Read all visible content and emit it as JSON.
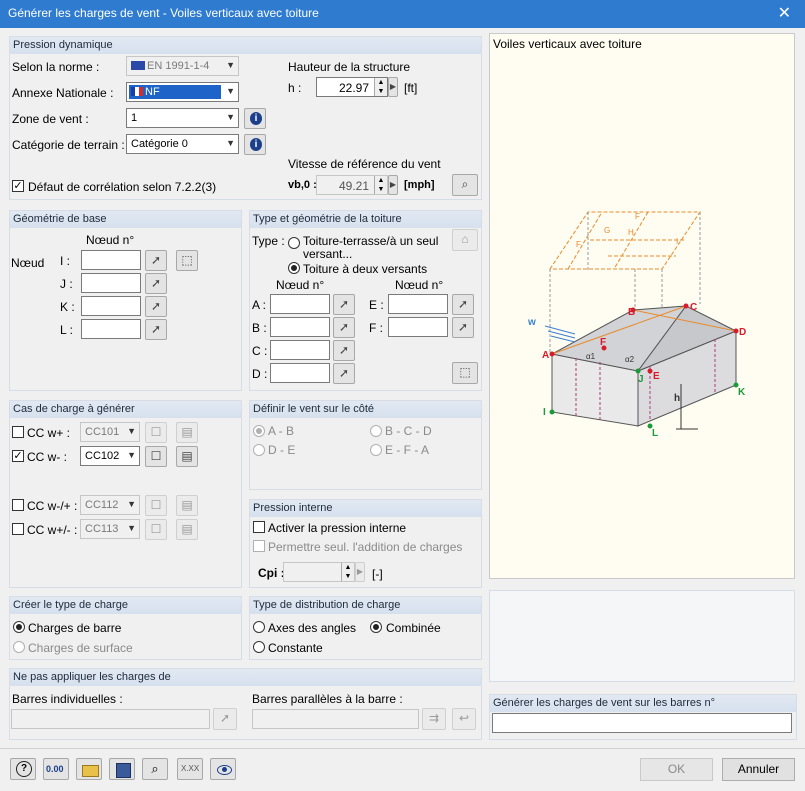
{
  "window": {
    "title": "Générer les charges de vent - Voiles verticaux avec toiture",
    "close": "✕"
  },
  "dyn": {
    "header": "Pression dynamique",
    "norme_label": "Selon la norme :",
    "norme_value": "EN 1991-1-4",
    "annexe_label": "Annexe Nationale :",
    "annexe_value": "NF",
    "zone_label": "Zone de vent :",
    "zone_value": "1",
    "terrain_label": "Catégorie de terrain :",
    "terrain_value": "Catégorie 0",
    "hauteur_label": "Hauteur de la structure",
    "h_label": "h :",
    "h_value": "22.97",
    "h_unit": "[ft]",
    "vitesse_label": "Vitesse de référence du vent",
    "vb_label": "vb,0 :",
    "vb_value": "49.21",
    "vb_unit": "[mph]",
    "correlation_label": "Défaut de corrélation selon 7.2.2(3)"
  },
  "geom": {
    "header": "Géométrie de base",
    "noeud_head": "Nœud n°",
    "noeud": "Nœud",
    "rows": [
      "I :",
      "J :",
      "K :",
      "L :"
    ]
  },
  "roof": {
    "header": "Type et géométrie de la toiture",
    "type_label": "Type :",
    "opt1": "Toiture-terrasse/à un seul",
    "opt1b": "versant...",
    "opt2": "Toiture à deux versants",
    "noeud_head1": "Nœud n°",
    "noeud_head2": "Nœud n°",
    "left": [
      "A :",
      "B :",
      "C :",
      "D :"
    ],
    "right": [
      "E :",
      "F :"
    ]
  },
  "cases": {
    "header": "Cas de charge à générer",
    "rows": [
      {
        "label": "CC w+ :",
        "value": "CC101",
        "checked": false
      },
      {
        "label": "CC w- :",
        "value": "CC102",
        "checked": true
      },
      {
        "label": "CC w-/+ :",
        "value": "CC112",
        "checked": false
      },
      {
        "label": "CC w+/- :",
        "value": "CC113",
        "checked": false
      }
    ]
  },
  "side": {
    "header": "Définir le vent sur le côté",
    "ab": "A - B",
    "bcd": "B - C - D",
    "de": "D - E",
    "efa": "E - F - A"
  },
  "pint": {
    "header": "Pression interne",
    "activer": "Activer la pression interne",
    "permettre": "Permettre seul. l'addition de charges",
    "cpi": "Cpi :",
    "unit": "[-]"
  },
  "creer": {
    "header": "Créer le type de charge",
    "barre": "Charges de barre",
    "surface": "Charges de surface"
  },
  "distr": {
    "header": "Type de distribution de charge",
    "axes": "Axes des angles",
    "combinee": "Combinée",
    "constante": "Constante"
  },
  "nepas": {
    "header": "Ne pas appliquer les charges de",
    "barres_ind": "Barres individuelles :",
    "barres_par": "Barres parallèles à la barre :"
  },
  "preview": {
    "title": "Voiles verticaux avec toiture",
    "w": "w",
    "labels": {
      "A": "A",
      "B": "B",
      "C": "C",
      "D": "D",
      "E": "E",
      "F": "F",
      "I": "I",
      "J": "J",
      "K": "K",
      "L": "L",
      "h": "h",
      "a1": "α1",
      "a2": "α2"
    },
    "roof_letters": [
      "F",
      "G",
      "H",
      "I",
      "F"
    ]
  },
  "generer": {
    "header": "Générer les charges de vent sur les barres n°"
  },
  "buttons": {
    "ok": "OK",
    "annuler": "Annuler",
    "zero": "0.00",
    "xxx": "X.XX"
  },
  "colors": {
    "title_bar": "#2e7bd0",
    "preview_bg": "#fffdf1",
    "node": "#d81b2b",
    "node_green": "#1b9a3a",
    "roof": "#e88a2a"
  }
}
